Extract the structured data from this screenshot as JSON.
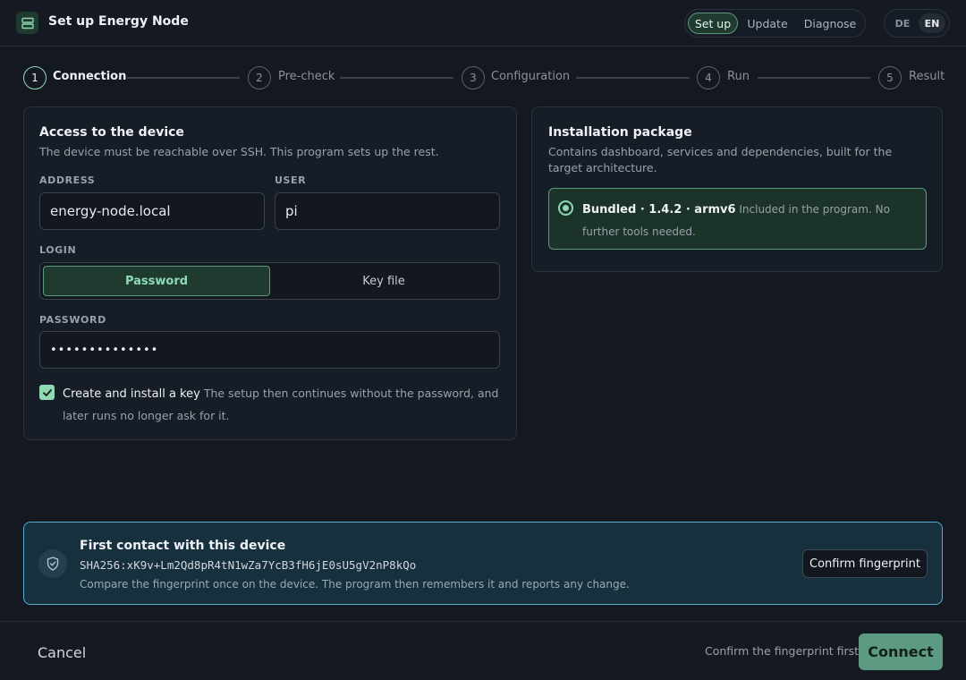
{
  "header": {
    "title": "Set up Energy Node",
    "app_icon": "server-icon",
    "modes": [
      "Set up",
      "Update",
      "Diagnose"
    ],
    "active_mode": "Set up",
    "languages": [
      "DE",
      "EN"
    ],
    "active_language": "EN"
  },
  "stepper": {
    "steps": [
      {
        "number": "1",
        "label": "Connection",
        "active": true
      },
      {
        "number": "2",
        "label": "Pre-check",
        "active": false
      },
      {
        "number": "3",
        "label": "Configuration",
        "active": false
      },
      {
        "number": "4",
        "label": "Run",
        "active": false
      },
      {
        "number": "5",
        "label": "Result",
        "active": false
      }
    ]
  },
  "access": {
    "title": "Access to the device",
    "description": "The device must be reachable over SSH. This program sets up the rest.",
    "address_label": "ADDRESS",
    "address_value": "energy-node.local",
    "user_label": "USER",
    "user_value": "pi",
    "login_label": "LOGIN",
    "login_options": [
      "Password",
      "Key file"
    ],
    "login_selected": "Password",
    "password_label": "PASSWORD",
    "password_value": "••••••••••••••",
    "key_checkbox_checked": true,
    "key_checkbox_label": "Create and install a key",
    "key_checkbox_hint": "The setup then continues without the password, and later runs no longer ask for it."
  },
  "package": {
    "title": "Installation package",
    "description": "Contains dashboard, services and dependencies, built for the target architecture.",
    "option_title": "Bundled · 1.4.2 · armv6",
    "option_hint": "Included in the program. No further tools needed.",
    "option_selected": true
  },
  "fingerprint": {
    "icon": "shield-check-icon",
    "title": "First contact with this device",
    "value": "SHA256:xK9v+Lm2Qd8pR4tN1wZa7YcB3fH6jE0sU5gV2nP8kQo",
    "hint": "Compare the fingerprint once on the device. The program then remembers it and reports any change.",
    "confirm_label": "Confirm fingerprint"
  },
  "footer": {
    "cancel_label": "Cancel",
    "hint": "Confirm the fingerprint first.",
    "connect_label": "Connect"
  },
  "colors": {
    "accent": "#8fd9b5",
    "accent_bg": "#1f3a2e",
    "info_border": "#5aaecf",
    "background": "#131821"
  }
}
